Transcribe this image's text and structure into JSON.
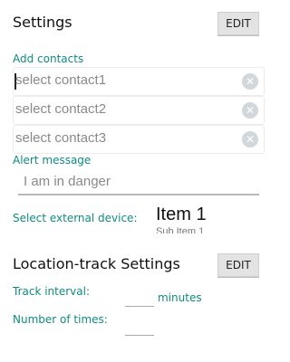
{
  "settings": {
    "title": "Settings",
    "edit_label": "EDIT",
    "add_contacts_label": "Add contacts",
    "contacts": [
      {
        "value": "select contact1"
      },
      {
        "value": "select contact2"
      },
      {
        "value": "select contact3"
      }
    ],
    "alert_label": "Alert message",
    "alert_value": "I am in danger",
    "external_device_label": "Select external device:",
    "external_device_value": "Item 1",
    "external_device_next": "Sub Item 1"
  },
  "location": {
    "title": "Location-track Settings",
    "edit_label": "EDIT",
    "track_interval_label": "Track interval:",
    "track_interval_unit": "minutes",
    "number_of_times_label": "Number of times:"
  },
  "icons": {
    "clear": "clear-icon"
  }
}
